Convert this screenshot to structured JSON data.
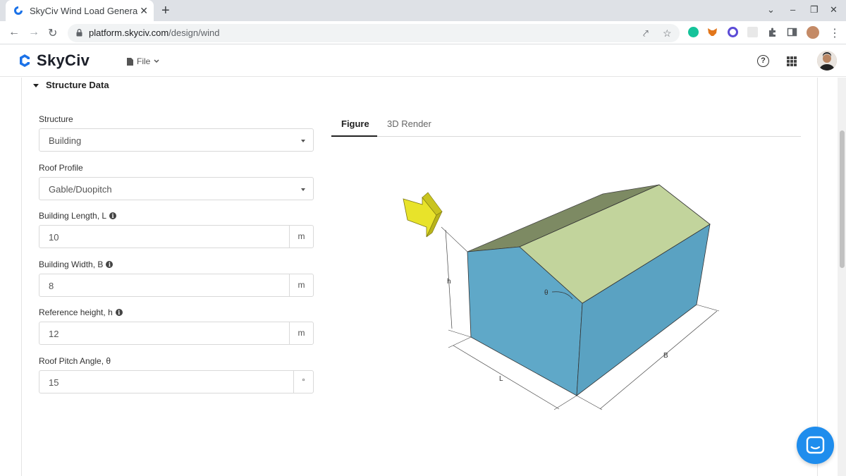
{
  "browser": {
    "tab_title": "SkyCiv Wind Load Genera",
    "tab_close": "✕",
    "new_tab": "+",
    "url_host": "platform.skyciv.com",
    "url_path": "/design/wind",
    "window_controls": [
      "⌄",
      "–",
      "❐",
      "✕"
    ],
    "nav": {
      "back": "←",
      "forward": "→",
      "reload": "↻",
      "menu": "⋮"
    },
    "omni_icons": {
      "share": "⤤",
      "star": "☆"
    },
    "toolbar_icons": [
      "grammarly-icon",
      "metamask-icon",
      "extension-circle-icon",
      "extension-square-icon",
      "puzzle-icon",
      "sidepanel-icon",
      "profile-avatar"
    ]
  },
  "app": {
    "logo_text": "SkyCiv",
    "file_menu_label": "File",
    "help_label": "?",
    "brand_color": "#1b72e8"
  },
  "section": {
    "title": "Structure Data"
  },
  "form": {
    "structure": {
      "label": "Structure",
      "value": "Building"
    },
    "roof_profile": {
      "label": "Roof Profile",
      "value": "Gable/Duopitch"
    },
    "building_length": {
      "label": "Building Length, L",
      "value": "10",
      "unit": "m"
    },
    "building_width": {
      "label": "Building Width, B",
      "value": "8",
      "unit": "m"
    },
    "reference_height": {
      "label": "Reference height, h",
      "value": "12",
      "unit": "m"
    },
    "roof_pitch": {
      "label": "Roof Pitch Angle, θ",
      "value": "15",
      "unit": "°"
    }
  },
  "tabs": [
    {
      "label": "Figure",
      "active": true
    },
    {
      "label": "3D Render",
      "active": false
    }
  ],
  "figure": {
    "dim_h": "h",
    "dim_theta": "θ",
    "dim_L": "L",
    "dim_B": "B",
    "colors": {
      "wall": "#5fa8c8",
      "wall_side": "#5aa2c2",
      "roof_light": "#c2d49c",
      "roof_dark": "#7d8a63",
      "arrow": "#e8e32a"
    }
  }
}
